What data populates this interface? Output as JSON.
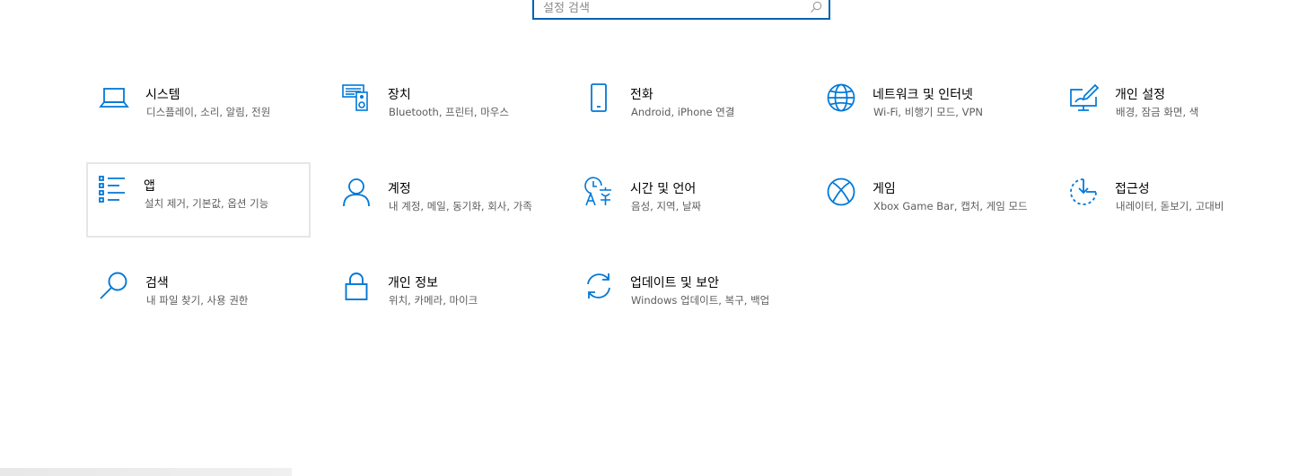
{
  "search": {
    "placeholder": "설정 검색",
    "icon": "search-icon"
  },
  "tiles": [
    {
      "id": "system",
      "title": "시스템",
      "desc": "디스플레이, 소리, 알림, 전원",
      "icon": "laptop-icon"
    },
    {
      "id": "devices",
      "title": "장치",
      "desc": "Bluetooth, 프린터, 마우스",
      "icon": "devices-icon"
    },
    {
      "id": "phone",
      "title": "전화",
      "desc": "Android, iPhone 연결",
      "icon": "phone-icon"
    },
    {
      "id": "network",
      "title": "네트워크 및 인터넷",
      "desc": "Wi-Fi, 비행기 모드, VPN",
      "icon": "globe-icon"
    },
    {
      "id": "personalization",
      "title": "개인 설정",
      "desc": "배경, 잠금 화면, 색",
      "icon": "personalization-icon"
    },
    {
      "id": "apps",
      "title": "앱",
      "desc": "설치 제거, 기본값, 옵션 기능",
      "icon": "apps-list-icon"
    },
    {
      "id": "accounts",
      "title": "계정",
      "desc": "내 계정, 메일, 동기화, 회사, 가족",
      "icon": "person-icon"
    },
    {
      "id": "time-language",
      "title": "시간 및 언어",
      "desc": "음성, 지역, 날짜",
      "icon": "time-language-icon"
    },
    {
      "id": "gaming",
      "title": "게임",
      "desc": "Xbox Game Bar, 캡처, 게임 모드",
      "icon": "xbox-icon"
    },
    {
      "id": "ease-of-access",
      "title": "접근성",
      "desc": "내레이터, 돋보기, 고대비",
      "icon": "ease-of-access-icon"
    },
    {
      "id": "search",
      "title": "검색",
      "desc": "내 파일 찾기, 사용 권한",
      "icon": "magnifier-icon"
    },
    {
      "id": "privacy",
      "title": "개인 정보",
      "desc": "위치, 카메라, 마이크",
      "icon": "lock-icon"
    },
    {
      "id": "update-security",
      "title": "업데이트 및 보안",
      "desc": "Windows 업데이트, 복구, 백업",
      "icon": "sync-icon"
    }
  ],
  "colors": {
    "accent": "#0078d7",
    "search_border": "#0063b1",
    "title": "#000000",
    "desc": "#5d5d5d",
    "selected_border": "#e6e6e6"
  }
}
